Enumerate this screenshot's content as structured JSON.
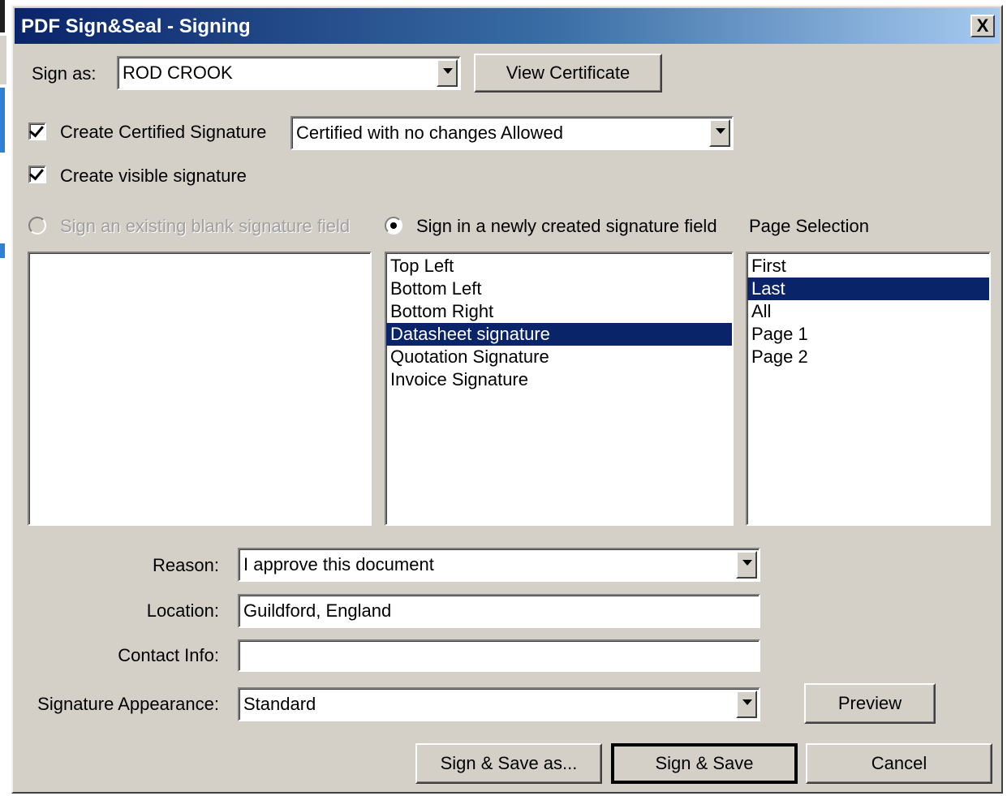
{
  "window": {
    "title": "PDF Sign&Seal - Signing",
    "close_label": "X"
  },
  "sign_as": {
    "label": "Sign as:",
    "value": "ROD CROOK",
    "view_certificate": "View Certificate"
  },
  "certified": {
    "label": "Create Certified Signature",
    "checked": true,
    "option": "Certified with no changes Allowed"
  },
  "visible": {
    "label": "Create visible signature",
    "checked": true
  },
  "placement": {
    "existing_label": "Sign an existing blank signature field",
    "new_label": "Sign in a newly created signature field",
    "selected": "new",
    "page_selection_label": "Page Selection"
  },
  "existing_fields": [],
  "new_fields": [
    "Top Left",
    "Bottom Left",
    "Bottom Right",
    "Datasheet signature",
    "Quotation Signature",
    "Invoice Signature"
  ],
  "new_fields_selected": "Datasheet signature",
  "pages": [
    "First",
    "Last",
    "All",
    "Page 1",
    "Page 2"
  ],
  "pages_selected": "Last",
  "form": {
    "reason_label": "Reason:",
    "reason_value": "I approve this document",
    "location_label": "Location:",
    "location_value": "Guildford, England",
    "contact_label": "Contact Info:",
    "contact_value": "",
    "appearance_label": "Signature Appearance:",
    "appearance_value": "Standard",
    "preview": "Preview"
  },
  "buttons": {
    "sign_save_as": "Sign & Save as...",
    "sign_save": "Sign & Save",
    "cancel": "Cancel"
  }
}
